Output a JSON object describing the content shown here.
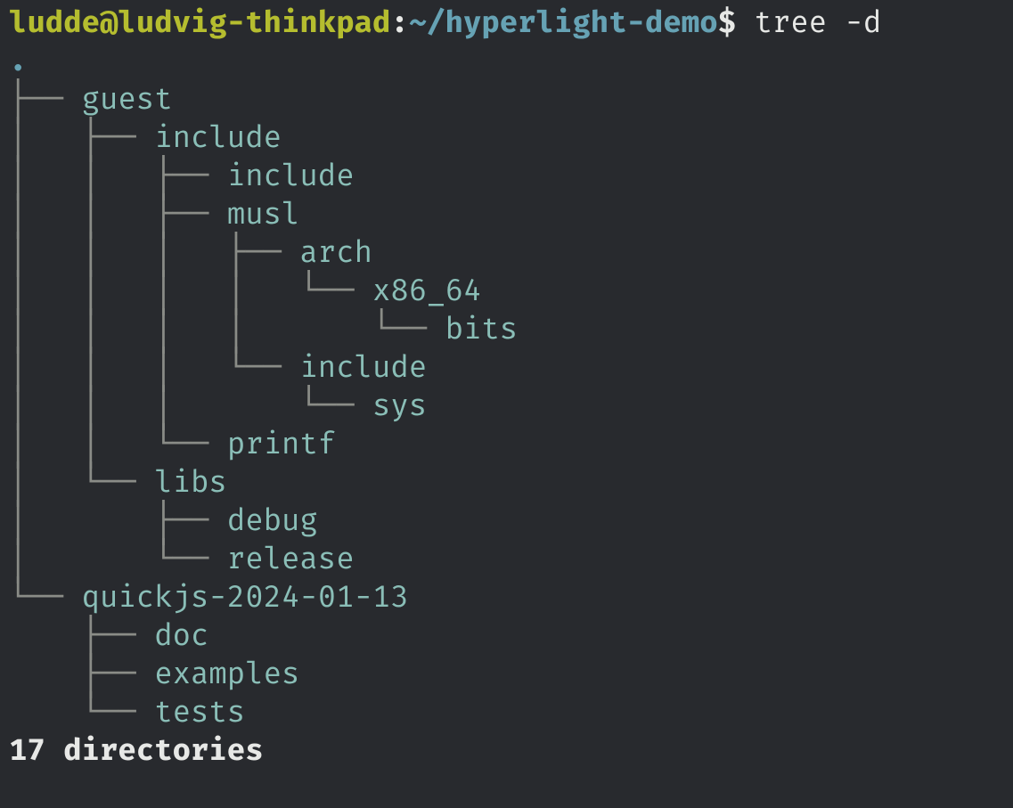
{
  "prompt": {
    "user": "ludde@ludvig-thinkpad",
    "colon": ":",
    "cwd": "~/hyperlight-demo",
    "dollar": "$",
    "command": "tree -d"
  },
  "tree": {
    "root": ".",
    "lines": [
      {
        "branch": "├── ",
        "name": "guest"
      },
      {
        "branch": "│   ├── ",
        "name": "include"
      },
      {
        "branch": "│   │   ├── ",
        "name": "include"
      },
      {
        "branch": "│   │   ├── ",
        "name": "musl"
      },
      {
        "branch": "│   │   │   ├── ",
        "name": "arch"
      },
      {
        "branch": "│   │   │   │   └── ",
        "name": "x86_64"
      },
      {
        "branch": "│   │   │   │       └── ",
        "name": "bits"
      },
      {
        "branch": "│   │   │   └── ",
        "name": "include"
      },
      {
        "branch": "│   │   │       └── ",
        "name": "sys"
      },
      {
        "branch": "│   │   └── ",
        "name": "printf"
      },
      {
        "branch": "│   └── ",
        "name": "libs"
      },
      {
        "branch": "│       ├── ",
        "name": "debug"
      },
      {
        "branch": "│       └── ",
        "name": "release"
      },
      {
        "branch": "└── ",
        "name": "quickjs-2024-01-13"
      },
      {
        "branch": "    ├── ",
        "name": "doc"
      },
      {
        "branch": "    ├── ",
        "name": "examples"
      },
      {
        "branch": "    └── ",
        "name": "tests"
      }
    ],
    "summary": "17 directories"
  }
}
